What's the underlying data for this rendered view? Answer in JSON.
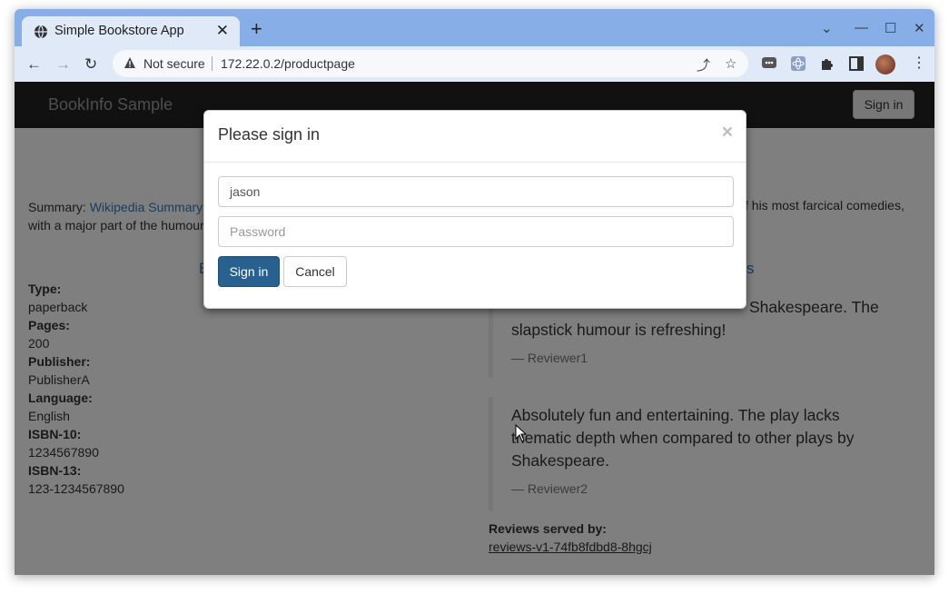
{
  "browser": {
    "tab_title": "Simple Bookstore App",
    "not_secure": "Not secure",
    "url": "172.22.0.2/productpage"
  },
  "navbar": {
    "brand": "BookInfo Sample",
    "sign_in": "Sign in"
  },
  "summary": {
    "label": "Summary:",
    "link": "Wikipedia Summary",
    "tail": "f his most farcical comedies,",
    "line2": "with a major part of the humour"
  },
  "sections": {
    "left_fragment": "B",
    "right_fragment": "s"
  },
  "details": [
    {
      "label": "Type:",
      "value": "paperback"
    },
    {
      "label": "Pages:",
      "value": "200"
    },
    {
      "label": "Publisher:",
      "value": "PublisherA"
    },
    {
      "label": "Language:",
      "value": "English"
    },
    {
      "label": "ISBN-10:",
      "value": "1234567890"
    },
    {
      "label": "ISBN-13:",
      "value": "123-1234567890"
    }
  ],
  "reviews": [
    {
      "text_visible": "Shakespeare. The",
      "line2": "slapstick humour is refreshing!",
      "by": "— Reviewer1"
    },
    {
      "text": "Absolutely fun and entertaining. The play lacks thematic depth when compared to other plays by Shakespeare.",
      "by": "— Reviewer2"
    }
  ],
  "served": {
    "label": "Reviews served by:",
    "pod": "reviews-v1-74fb8fdbd8-8hgcj"
  },
  "modal": {
    "title": "Please sign in",
    "close": "×",
    "username_value": "jason",
    "password_placeholder": "Password",
    "sign_in": "Sign in",
    "cancel": "Cancel"
  },
  "icons": {
    "favicon": "globe-icon",
    "warning": "warning-icon",
    "share": "share-icon",
    "star": "star-icon",
    "extensions": "puzzle-icon"
  }
}
